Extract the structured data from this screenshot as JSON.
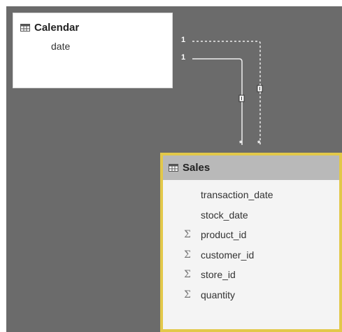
{
  "tables": {
    "calendar": {
      "name": "Calendar",
      "fields": [
        {
          "name": "date",
          "aggregated": false
        }
      ]
    },
    "sales": {
      "name": "Sales",
      "fields": [
        {
          "name": "transaction_date",
          "aggregated": false
        },
        {
          "name": "stock_date",
          "aggregated": false
        },
        {
          "name": "product_id",
          "aggregated": true
        },
        {
          "name": "customer_id",
          "aggregated": true
        },
        {
          "name": "store_id",
          "aggregated": true
        },
        {
          "name": "quantity",
          "aggregated": true
        }
      ]
    }
  },
  "relationships": [
    {
      "from_cardinality": "1",
      "to_cardinality": "*",
      "active": false
    },
    {
      "from_cardinality": "1",
      "to_cardinality": "*",
      "active": true
    }
  ],
  "colors": {
    "canvas": "#6b6b6b",
    "selected_border": "#e2c84a",
    "header_selected": "#b9b9b9"
  },
  "icons": {
    "table": "table-grid-icon",
    "sigma": "sigma-sum-icon"
  }
}
